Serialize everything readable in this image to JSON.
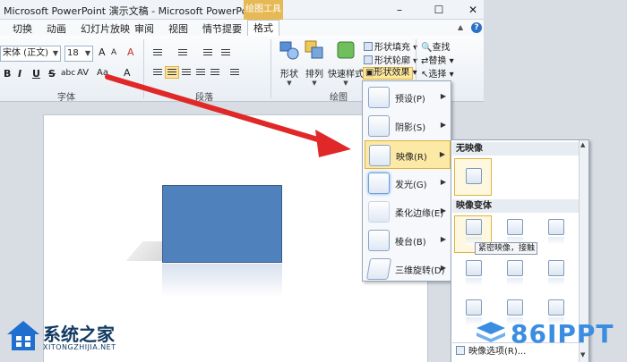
{
  "window": {
    "title": "Microsoft PowerPoint 演示文稿 - Microsoft PowerPoint",
    "context_tab": "绘图工具",
    "minimize": "–",
    "maximize": "☐",
    "close": "✕"
  },
  "tabs": [
    "切换",
    "动画",
    "幻灯片放映",
    "审阅",
    "视图",
    "情节提要",
    "格式"
  ],
  "ribbon": {
    "font_name": "宋体 (正文)",
    "font_size": "18",
    "grow_font": "A",
    "shrink_font": "A",
    "clear_format": "A",
    "bold": "B",
    "italic": "I",
    "underline": "U",
    "strike": "S",
    "shadow_text": "abc",
    "spacing": "AV",
    "case": "Aa",
    "font_color": "A",
    "group_font": "字体",
    "group_paragraph": "段落",
    "group_drawing": "绘图",
    "shape_label": "形状",
    "arrange_label": "排列",
    "quick_styles_label": "快速样式",
    "shape_fill": "形状填充",
    "shape_outline": "形状轮廓",
    "shape_effects": "形状效果",
    "find": "查找",
    "replace": "替换",
    "select": "选择"
  },
  "menu": {
    "items": [
      {
        "label": "预设(P)",
        "icon": "preset-icon"
      },
      {
        "label": "阴影(S)",
        "icon": "shadow-icon"
      },
      {
        "label": "映像(R)",
        "icon": "reflection-icon"
      },
      {
        "label": "发光(G)",
        "icon": "glow-icon"
      },
      {
        "label": "柔化边缘(E)",
        "icon": "soft-edges-icon"
      },
      {
        "label": "棱台(B)",
        "icon": "bevel-icon"
      },
      {
        "label": "三维旋转(D)",
        "icon": "3d-rotation-icon"
      }
    ]
  },
  "gallery": {
    "no_reflection": "无映像",
    "variants": "映像变体",
    "tooltip": "紧密映像，接触",
    "options": "映像选项(R)..."
  },
  "watermark": {
    "left_title": "系统之家",
    "left_sub": "XITONGZHIJIA.NET",
    "right": "86IPPT"
  },
  "colors": {
    "accent": "#e0b33f",
    "shape": "#4f81bd",
    "arrow": "#e02828"
  }
}
